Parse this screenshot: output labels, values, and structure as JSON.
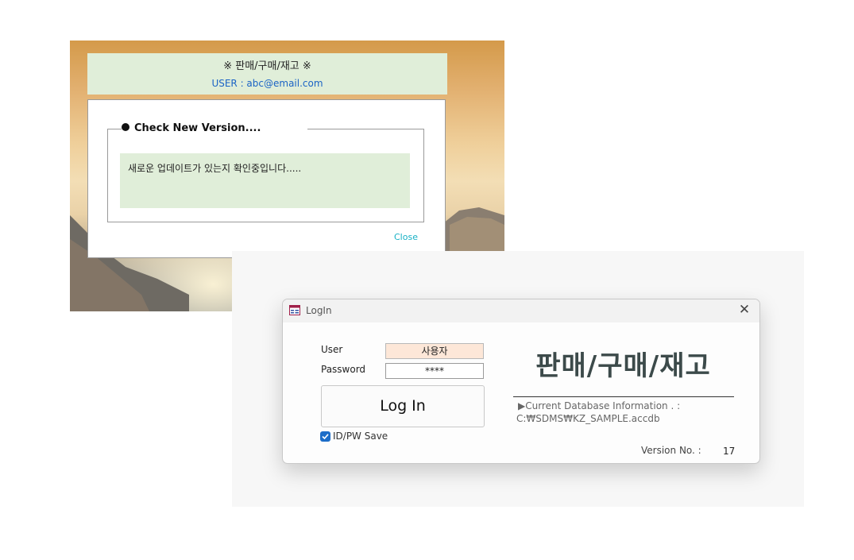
{
  "update_window": {
    "title": "※ 판매/구매/재고 ※",
    "user_label": "USER : abc@email.com",
    "group_title": "Check New Version....",
    "message": "새로운 업데이트가 있는지 확인중입니다.....",
    "close_label": "Close"
  },
  "login_window": {
    "title": "LogIn",
    "user_label": "User",
    "user_value": "사용자",
    "password_label": "Password",
    "password_value": "****",
    "login_button": "Log In",
    "save_label": "ID/PW Save",
    "save_checked": true,
    "app_title": "판매/구매/재고",
    "db_info_label": "▶Current Database Information . :",
    "db_path": "C:₩SDMS₩KZ_SAMPLE.accdb",
    "version_label": "Version No. :",
    "version_value": "17",
    "close_icon": "close-icon",
    "app_icon": "form-icon"
  },
  "colors": {
    "header_green": "#e0eed9",
    "user_blue": "#1a63c5",
    "close_cyan": "#17b1c5",
    "user_field_bg": "#fde7d8",
    "title_slate": "#3c4a4a",
    "checkbox_blue": "#1c6dc8"
  }
}
